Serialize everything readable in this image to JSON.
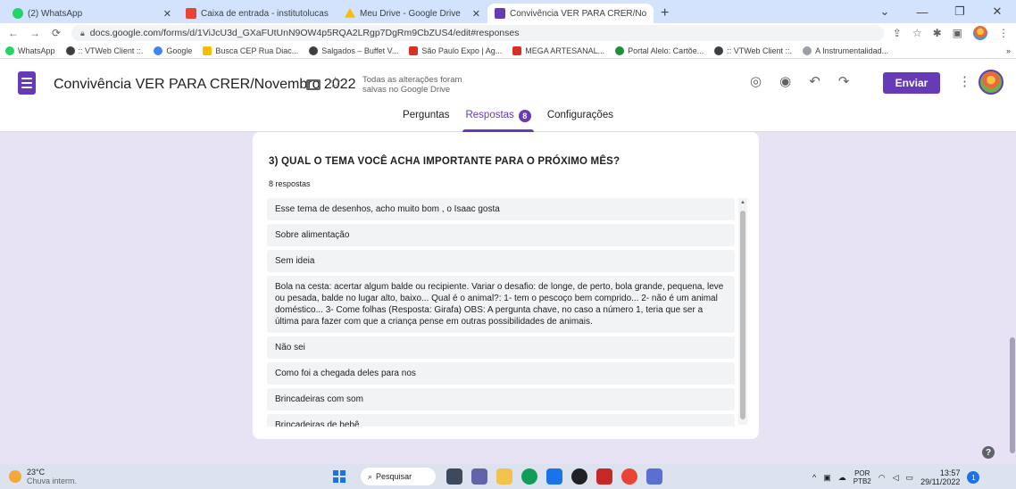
{
  "browser": {
    "tabs": [
      {
        "title": "(2) WhatsApp",
        "icon": "whatsapp-icon",
        "color": "#25d366",
        "active": false
      },
      {
        "title": "Caixa de entrada - institutolucas",
        "icon": "gmail-icon",
        "color": "#ea4335",
        "active": false
      },
      {
        "title": "Meu Drive - Google Drive",
        "icon": "drive-icon",
        "color": "#fbbc04",
        "active": false
      },
      {
        "title": "Convivência VER PARA CRER/No",
        "icon": "forms-icon",
        "color": "#673ab7",
        "active": true
      }
    ],
    "url": "docs.google.com/forms/d/1ViJcU3d_GXaFUtUnN9OW4p5RQA2LRgp7DgRm9CbZUS4/edit#responses",
    "bookmarks": [
      {
        "label": "WhatsApp",
        "color": "#25d366"
      },
      {
        "label": ":: VTWeb Client ::.",
        "color": "#3c4043"
      },
      {
        "label": "Google",
        "color": "#4285f4"
      },
      {
        "label": "Busca CEP Rua Diac...",
        "color": "#fbbc04"
      },
      {
        "label": "Salgados – Buffet V...",
        "color": "#3c4043"
      },
      {
        "label": "São Paulo Expo | Ag...",
        "color": "#d93025"
      },
      {
        "label": "MEGA ARTESANAL...",
        "color": "#d93025"
      },
      {
        "label": "Portal Alelo: Cartõe...",
        "color": "#1e8e3e"
      },
      {
        "label": ":: VTWeb Client ::.",
        "color": "#3c4043"
      },
      {
        "label": "A Instrumentalidad...",
        "color": "#9aa0a6"
      }
    ]
  },
  "form": {
    "title": "Convivência VER PARA CRER/Novembro 2022",
    "save_status": "Todas as alterações foram salvas no Google Drive",
    "send_label": "Enviar",
    "tabs": {
      "questions": "Perguntas",
      "responses": "Respostas",
      "responses_count": "8",
      "settings": "Configurações"
    },
    "accent": "#673ab7"
  },
  "question": {
    "title": "3) QUAL O TEMA VOCÊ ACHA IMPORTANTE PARA O PRÓXIMO MÊS?",
    "count_label": "8 respostas",
    "answers": [
      "Esse tema de desenhos, acho muito bom , o Isaac gosta",
      "Sobre alimentação",
      "Sem ideia",
      "Bola na cesta: acertar algum balde ou recipiente. Variar o desafio: de longe, de perto, bola grande, pequena, leve ou pesada, balde no lugar alto, baixo... Qual é o animal?: 1- tem o pescoço bem comprido... 2- não é um animal doméstico... 3- Come folhas (Resposta: Girafa) OBS: A pergunta chave, no caso a número 1, teria que ser a última para fazer com que a criança pense em outras possibilidades de animais.",
      "Não sei",
      "Como foi a chegada deles para nos",
      "Brincadeiras com som",
      "Brincadeiras de bebê"
    ]
  },
  "taskbar": {
    "temperature": "23°C",
    "weather": "Chuva interm.",
    "search_label": "Pesquisar",
    "lang_1": "POR",
    "lang_2": "PTB2",
    "time": "13:57",
    "date": "29/11/2022",
    "notifications": "1"
  }
}
